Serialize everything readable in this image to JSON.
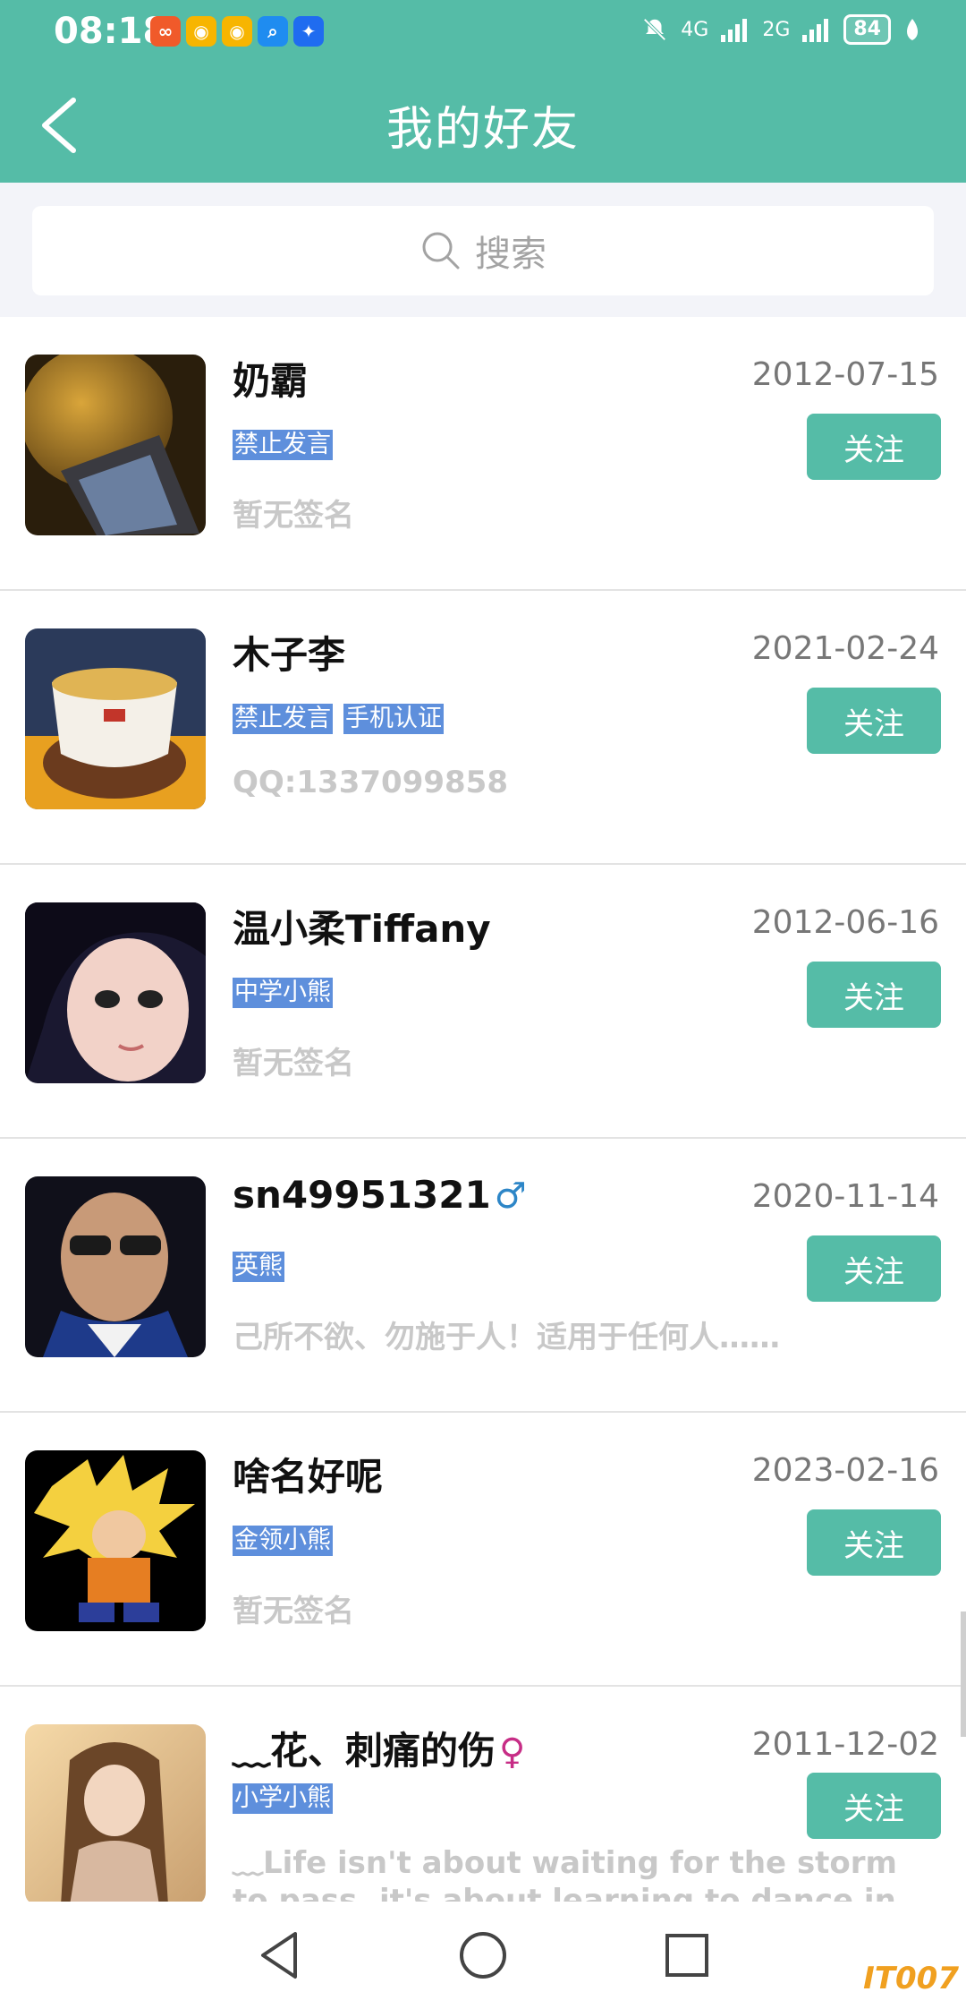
{
  "status_bar": {
    "time": "08:18",
    "network1": "4G",
    "network2": "2G",
    "battery": "84",
    "apps": [
      {
        "icon": "app-icon-1",
        "color": "#f05a2a",
        "glyph": "∞"
      },
      {
        "icon": "weibo-icon-1",
        "color": "#f7b500",
        "glyph": "◉"
      },
      {
        "icon": "weibo-icon-2",
        "color": "#f7b500",
        "glyph": "◉"
      },
      {
        "icon": "search-app-icon",
        "color": "#1f8cf0",
        "glyph": "⌕"
      },
      {
        "icon": "bulb-app-icon",
        "color": "#1f6cf0",
        "glyph": "✦"
      }
    ]
  },
  "header": {
    "title": "我的好友"
  },
  "search": {
    "placeholder": "搜索"
  },
  "friends": [
    {
      "name": "奶霸",
      "date": "2012-07-15",
      "tags": [
        "禁止发言"
      ],
      "signature": "暂无签名",
      "follow_label": "关注"
    },
    {
      "name": "木子李",
      "date": "2021-02-24",
      "tags": [
        "禁止发言",
        "手机认证"
      ],
      "signature": "QQ:1337099858",
      "follow_label": "关注"
    },
    {
      "name": "温小柔Tiffany",
      "date": "2012-06-16",
      "tags": [
        "中学小熊"
      ],
      "signature": "暂无签名",
      "follow_label": "关注"
    },
    {
      "name": "sn49951321",
      "gender": "♂",
      "date": "2020-11-14",
      "tags": [
        "英熊"
      ],
      "signature": "己所不欲、勿施于人！适用于任何人……",
      "follow_label": "关注"
    },
    {
      "name": "啥名好呢",
      "date": "2023-02-16",
      "tags": [
        "金领小熊"
      ],
      "signature": "暂无签名",
      "follow_label": "关注"
    },
    {
      "name": "﹏花、刺痛的伤",
      "gender": "♀",
      "date": "2011-12-02",
      "tags": [
        "小学小熊"
      ],
      "signature": "﹏Life isn't about waiting for the storm to pass, it's about learning to dance in the",
      "follow_label": "关注"
    }
  ],
  "watermark": "IT007",
  "colors": {
    "accent": "#55bca7",
    "tag": "#5e8fdc"
  }
}
